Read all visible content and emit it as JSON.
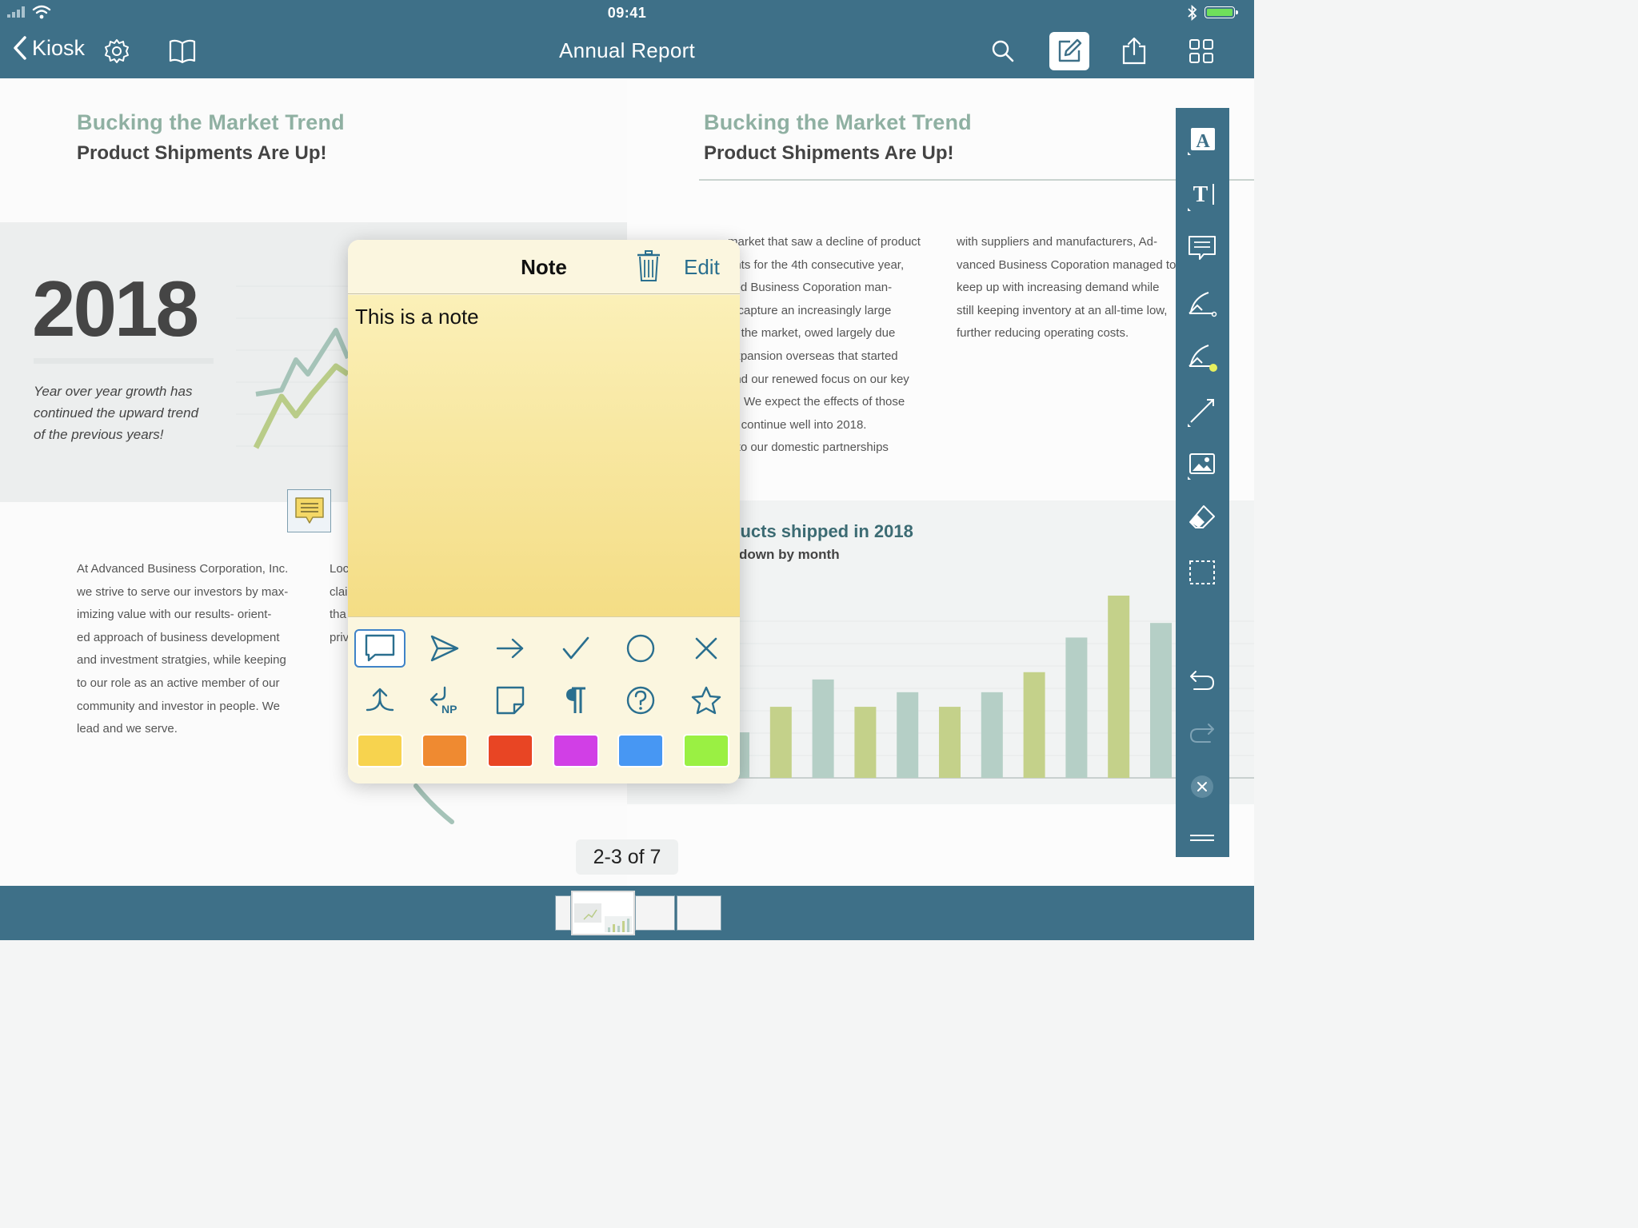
{
  "status_bar": {
    "time": "09:41",
    "icons": [
      "cellular-signal-icon",
      "wifi-icon",
      "bluetooth-icon",
      "battery-icon"
    ]
  },
  "nav": {
    "back_label": "Kiosk",
    "title": "Annual Report",
    "icons": [
      "back-chevron-icon",
      "gear-icon",
      "book-icon",
      "search-icon",
      "annotate-icon",
      "share-icon",
      "grid-icon"
    ]
  },
  "left_page": {
    "heading": "Bucking the Market Trend",
    "subheading": "Product Shipments Are Up!",
    "year": "2018",
    "quote": [
      "Year over year growth has",
      "continued the upward trend",
      "of the previous years!"
    ],
    "body_col1": [
      "At Advanced Business Corporation, Inc.",
      "we strive to serve our investors  by max-",
      "imizing value with our results- orient-",
      "ed approach of business development",
      "and investment stratgies, while keeping",
      "to our role as an active member of our",
      "community and investor in people. We",
      "lead and we serve."
    ],
    "body_col2": [
      "Loc",
      "clai",
      "tha",
      "priv"
    ]
  },
  "right_page": {
    "heading": "Bucking the Market Trend",
    "subheading": "Product Shipments Are Up!",
    "body_col1": [
      "market that saw a decline of product",
      "ents for the 4th consecutive year,",
      "ced Business Coporation man-",
      "o capture an increasingly large",
      "of the market, owed largely due",
      "expansion overseas that started",
      "and our renewed focus on our key",
      "ts. We expect the effects of those",
      "to continue well into 2018.",
      "s to our domestic partnerships"
    ],
    "body_col2": [
      "with suppliers and manufacturers, Ad-",
      "vanced Business Coporation managed to",
      "keep up with increasing demand while",
      "still keeping inventory at an all-time low,",
      "further reducing operating costs."
    ],
    "chart_title": "ducts shipped in 2018",
    "chart_subtitle": "down by month"
  },
  "chart_data": {
    "type": "bar",
    "title": "ducts shipped in 2018",
    "series": [
      {
        "values": [
          0.25,
          0.39,
          0.54,
          0.39,
          0.47,
          0.39,
          0.47,
          0.58,
          0.77,
          1.0,
          0.85
        ]
      }
    ],
    "ylim": [
      0,
      1
    ],
    "colors": [
      "#b5cfc6",
      "#c4d18a"
    ],
    "grid": true
  },
  "note": {
    "title": "Note",
    "edit_label": "Edit",
    "text": "This is a note",
    "icons_row1": [
      "comment-icon",
      "paper-plane-icon",
      "arrow-right-icon",
      "checkmark-icon",
      "circle-icon",
      "cross-icon"
    ],
    "icons_row2": [
      "insert-icon",
      "new-paragraph-icon",
      "sticky-note-icon",
      "paragraph-icon",
      "help-icon",
      "star-icon"
    ],
    "colors": [
      "#f7d34e",
      "#ef8a31",
      "#e84524",
      "#d13fe6",
      "#4797f3",
      "#9af043"
    ],
    "selected_icon": "comment-icon"
  },
  "tool_palette": {
    "tools": [
      "text-box-icon",
      "typewriter-icon",
      "note-icon",
      "pen-icon",
      "highlighter-icon",
      "line-icon",
      "image-icon",
      "eraser-icon",
      "selection-icon",
      "undo-icon",
      "redo-icon",
      "close-icon",
      "handle-icon"
    ]
  },
  "page_indicator": "2-3 of 7"
}
